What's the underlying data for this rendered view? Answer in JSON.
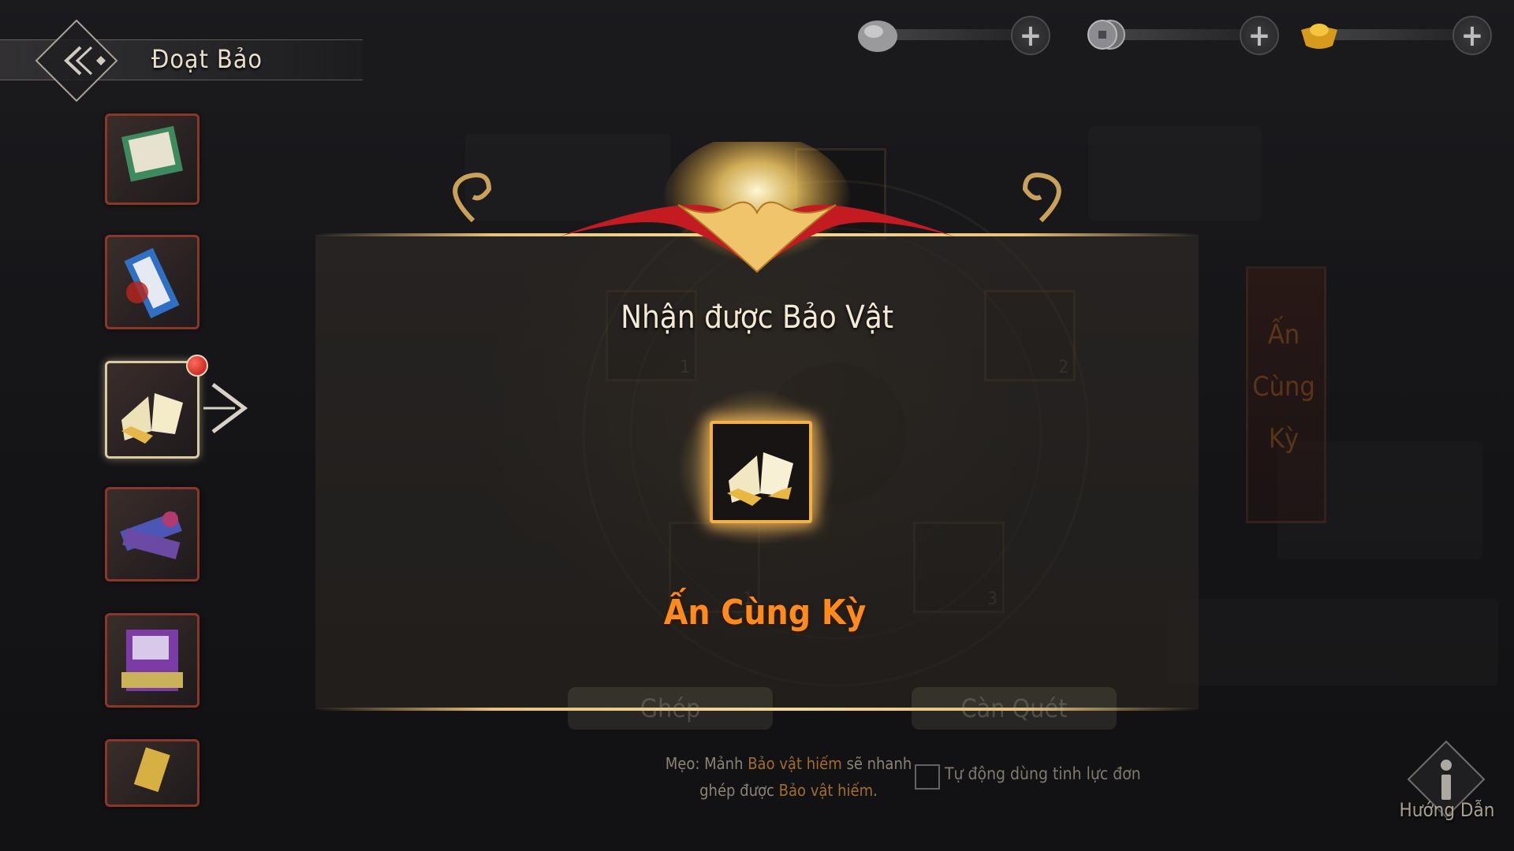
{
  "header": {
    "title": "Đoạt Bảo"
  },
  "currencies": [
    {
      "name": "silver-ore",
      "value": ""
    },
    {
      "name": "coin",
      "value": ""
    },
    {
      "name": "gold-ingot",
      "value": ""
    }
  ],
  "plus_symbol": "+",
  "popup": {
    "title": "Nhận được Bảo Vật",
    "item_name": "Ấn Cùng Kỳ"
  },
  "background": {
    "slot_numbers": [
      "1",
      "2",
      "1",
      "3"
    ],
    "buttons": [
      "Ghép",
      "Càn Quét"
    ],
    "side_banner": "Ấn Cùng Kỳ"
  },
  "footer": {
    "tip_prefix": "Mẹo: Mảnh ",
    "tip_hl1": "Bảo vật hiếm",
    "tip_mid": " sẽ nhanh",
    "tip_line2_prefix": "ghép được ",
    "tip_hl2": "Bảo vật hiếm",
    "tip_suffix": ".",
    "auto_label": "Tự động dùng tinh lực đơn"
  },
  "guide": {
    "label": "Hướng Dẫn"
  },
  "colors": {
    "accent_gold": "#e9c27a",
    "item_name": "#ff8a1e",
    "slot_border": "#8a3628"
  }
}
